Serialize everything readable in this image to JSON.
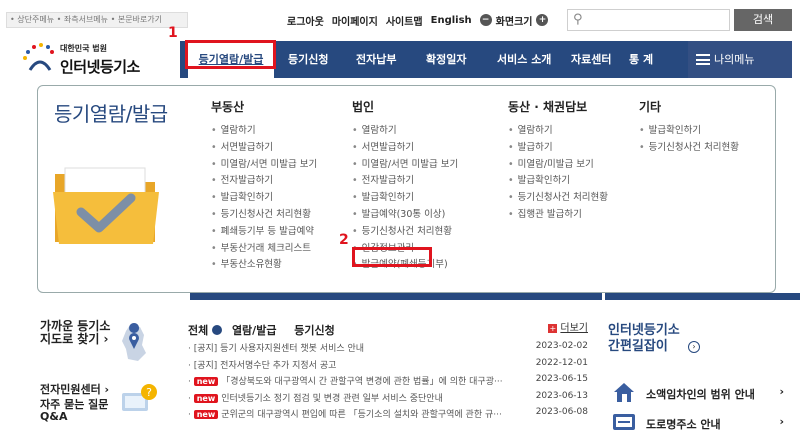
{
  "topbar": {
    "skip_links": "• 상단주메뉴 • 좌측서브메뉴 • 본문바로가기",
    "logout": "로그아웃",
    "mypage": "마이페이지",
    "sitemap": "사이트맵",
    "english": "English",
    "font_size": "화면크기",
    "font_minus": "−",
    "font_plus": "+",
    "search_placeholder": "",
    "search_button": "검색"
  },
  "logo": {
    "sub": "대한민국 법원",
    "main": "인터넷등기소"
  },
  "gnb": {
    "items": [
      "등기열람/발급",
      "등기신청",
      "전자납부",
      "확정일자",
      "서비스 소개",
      "자료센터",
      "통 계"
    ],
    "mymenu": "나의메뉴"
  },
  "annotations": {
    "first": "1",
    "second": "2"
  },
  "mega": {
    "title": "등기열람/발급",
    "columns": [
      {
        "heading": "부동산",
        "items": [
          "열람하기",
          "서면발급하기",
          "미열람/서면 미발급 보기",
          "전자발급하기",
          "발급확인하기",
          "등기신청사건 처리현황",
          "폐쇄등기부 등 발급예약",
          "부동산거래 체크리스트",
          "부동산소유현황"
        ]
      },
      {
        "heading": "법인",
        "items": [
          "열람하기",
          "서면발급하기",
          "미열람/서면 미발급 보기",
          "전자발급하기",
          "발급확인하기",
          "발급예약(30통 이상)",
          "등기신청사건 처리현황",
          "인감정보관리",
          "발급예약(폐쇄등기부)"
        ]
      },
      {
        "heading": "동산 · 채권담보",
        "items": [
          "열람하기",
          "발급하기",
          "미열람/미발급 보기",
          "발급확인하기",
          "등기신청사건 처리현황",
          "집행관 발급하기"
        ]
      },
      {
        "heading": "기타",
        "items": [
          "발급확인하기",
          "등기신청사건 처리현황"
        ]
      }
    ]
  },
  "left": {
    "map": "가까운 등기소\n지도로 찾기 ›",
    "center": "전자민원센터 ›",
    "faq": "자주 묻는 질문\nQ&A"
  },
  "board": {
    "tab_all": "전체",
    "tab1": "열람/발급",
    "tab2": "등기신청",
    "more": "더보기",
    "posts": [
      {
        "badge": "",
        "title": "· [공지] 등기 사용자지원센터 챗봇 서비스 안내",
        "date": "2023-02-02"
      },
      {
        "badge": "",
        "title": "· [공지] 전자서명수단 추가 지정서 공고",
        "date": "2022-12-01"
      },
      {
        "badge": "new",
        "title": "「경상북도와 대구광역시 간 관할구역 변경에 관한 법률」에 의한 대구광···",
        "date": "2023-06-15"
      },
      {
        "badge": "new",
        "title": "인터넷등기소 정기 점검 및 변경 관련 일부 서비스 중단안내",
        "date": "2023-06-13"
      },
      {
        "badge": "new",
        "title": "군위군의 대구광역시 편입에 따른 「등기소의 설치와 관할구역에 관한 규···",
        "date": "2023-06-08"
      }
    ]
  },
  "right": {
    "guide": "인터넷등기소\n간편길잡이",
    "svc1": "소액임차인의 범위 안내",
    "svc2": "도로명주소 안내",
    "arrow": "›"
  },
  "colors": {
    "primary": "#27497f",
    "highlight": "#e0141e"
  }
}
